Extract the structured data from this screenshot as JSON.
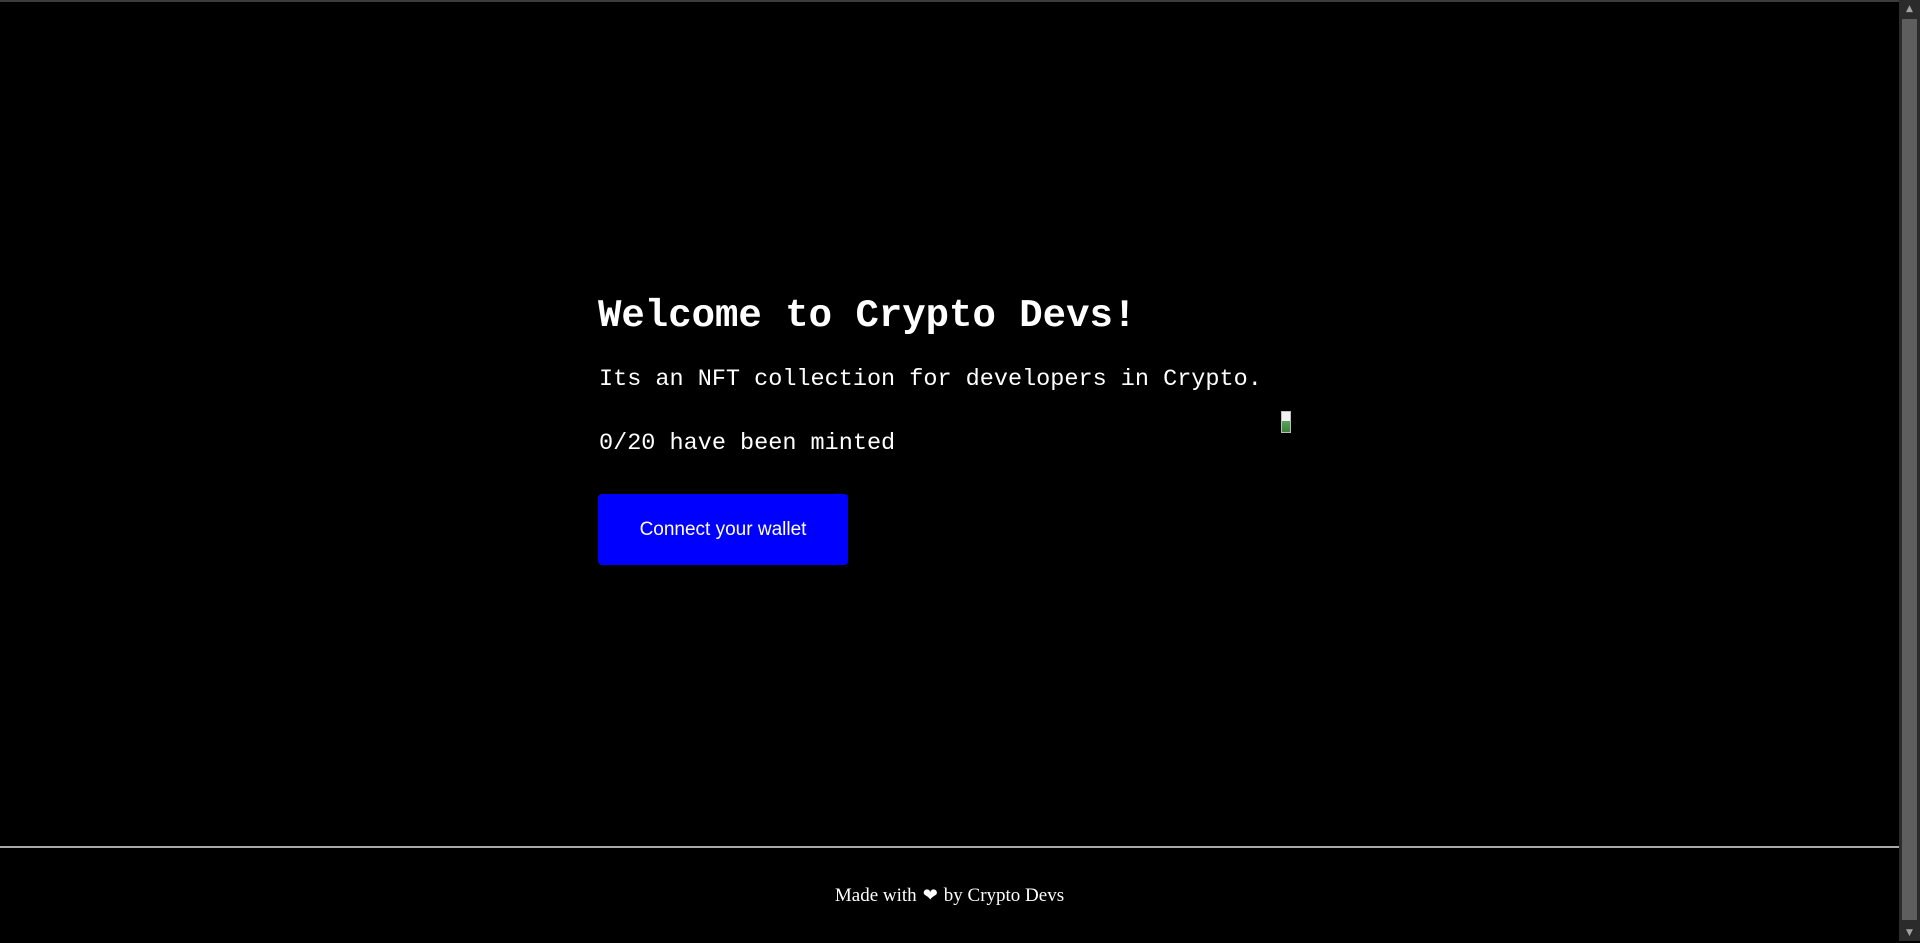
{
  "hero": {
    "title": "Welcome to Crypto Devs!",
    "description": "Its an NFT collection for developers in Crypto.",
    "minted_status": "0/20 have been minted",
    "connect_button_label": "Connect your wallet"
  },
  "footer": {
    "text_before": "Made with",
    "heart_symbol": "❤",
    "text_after": "by Crypto Devs"
  },
  "scrollbar": {
    "up_arrow": "▲",
    "down_arrow": "▼"
  },
  "colors": {
    "background": "#000000",
    "button": "#0000ff",
    "text": "#ffffff"
  },
  "icons": {
    "image_placeholder": "broken-image-icon",
    "heart": "heart-icon"
  }
}
